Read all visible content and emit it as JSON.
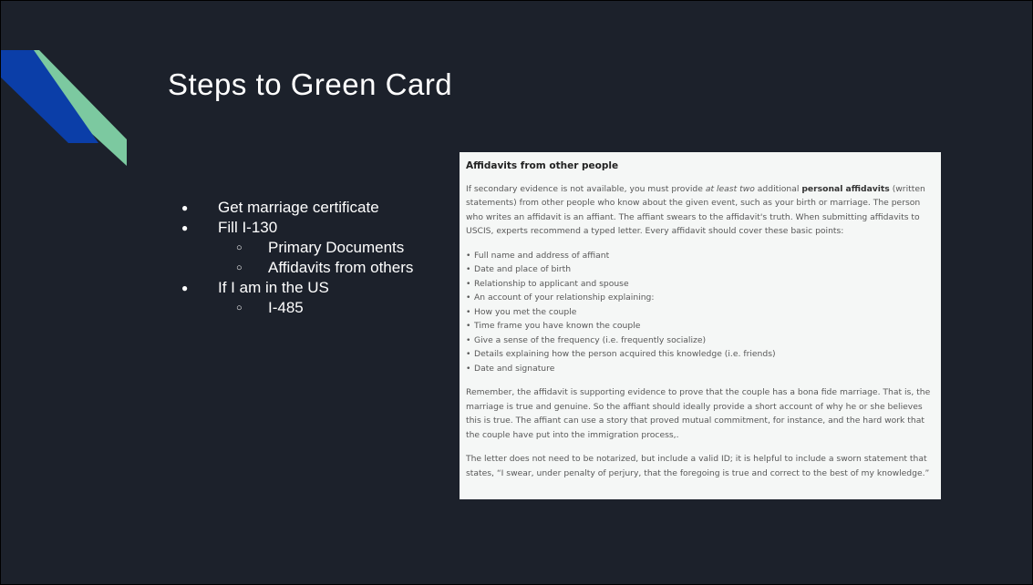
{
  "slide": {
    "title": "Steps to Green Card",
    "bullets": [
      {
        "level": 1,
        "text": "Get marriage certificate"
      },
      {
        "level": 1,
        "text": "Fill I-130"
      },
      {
        "level": 2,
        "text": "Primary Documents"
      },
      {
        "level": 2,
        "text": "Affidavits from others"
      },
      {
        "level": 1,
        "text": "If I am in the US"
      },
      {
        "level": 2,
        "text": "I-485"
      }
    ],
    "bullet_markers": {
      "level1": "●",
      "level2": "○"
    }
  },
  "document": {
    "heading": "Affidavits from other people",
    "intro": {
      "a": "If secondary evidence is not available, you must provide ",
      "b": "at least two",
      "c": " additional ",
      "d": "personal affidavits",
      "e": " (written statements) from other people who know about the given event, such as your birth or marriage. The person who writes an affidavit is an affiant. The affiant swears to the affidavit's truth. When submitting affidavits to USCIS, experts recommend a typed letter. Every affidavit should cover these basic points:"
    },
    "points": [
      "Full name and address of affiant",
      "Date and place of birth",
      "Relationship to applicant and spouse",
      "An account of your relationship explaining:",
      "How you met the couple",
      "Time frame you have known the couple",
      "Give a sense of the frequency (i.e. frequently socialize)",
      "Details explaining how the person acquired this knowledge (i.e. friends)",
      "Date and signature"
    ],
    "para2": "Remember, the affidavit is supporting evidence to prove that the couple has a bona fide marriage. That is, the marriage is true and genuine. So the affiant should ideally provide a short account of why he or she believes this is true. The affiant can use a story that proved mutual commitment, for instance, and the hard work that the couple have put into the immigration process,.",
    "para3": "The letter does not need to be notarized, but include a valid ID; it is helpful to include a sworn statement that states, “I swear, under penalty of perjury, that the foregoing is true and correct to the best of my knowledge.”"
  },
  "colors": {
    "background": "#1c212b",
    "accent_blue": "#0b3ea8",
    "accent_green": "#7cc9a0",
    "document_bg": "#f5f7f6"
  }
}
